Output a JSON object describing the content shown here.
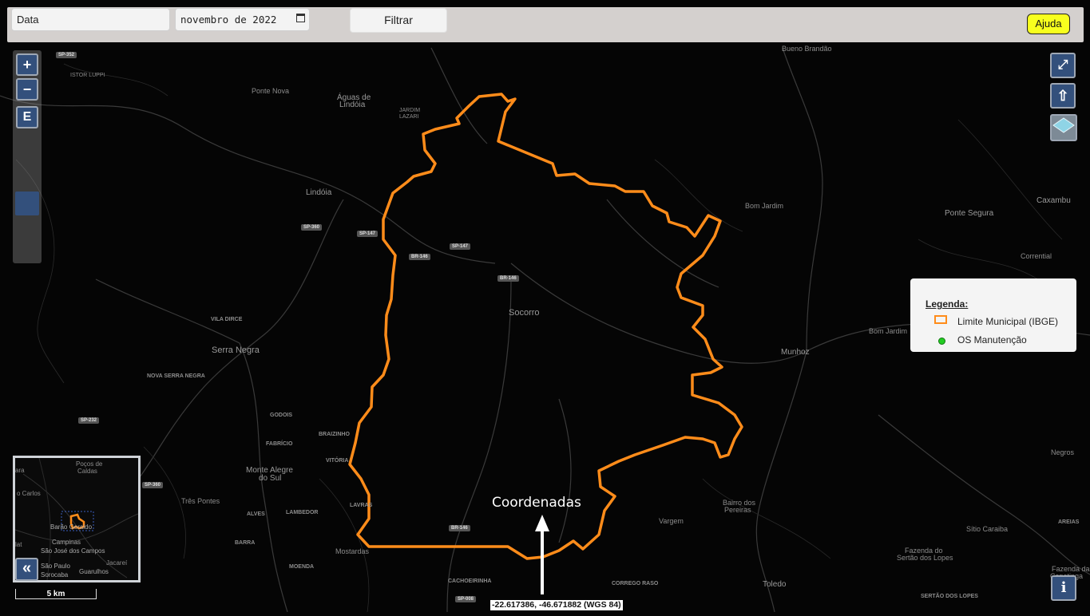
{
  "toolbar": {
    "date_label": "Data",
    "month_value": "novembro de 2022",
    "filter_label": "Filtrar",
    "help_label": "Ajuda"
  },
  "controls": {
    "zoom_in": "+",
    "zoom_out": "−",
    "extent": "E",
    "fullscreen_icon": "expand-icon",
    "home_icon": "up-arrow-icon",
    "layers_icon": "layers-icon",
    "minimap_toggle": "«",
    "info": "i"
  },
  "scale": {
    "label": "5 km"
  },
  "legend": {
    "title": "Legenda:",
    "items": [
      {
        "label": "Limite Municipal (IBGE)",
        "color": "#ff8c1a"
      },
      {
        "label": "OS Manutenção",
        "color": "#22cc22"
      }
    ]
  },
  "annotation": {
    "label": "Coordenadas"
  },
  "coordinates": {
    "readout": "-22.617386, -46.671882 (WGS 84)"
  },
  "places": {
    "bueno_brandao": "Bueno Brandão",
    "pinhalzinho_road": "SP-352",
    "istor_luppi": "ISTOR LUPPI",
    "ponte_nova": "Ponte Nova",
    "aguas": "Águas de",
    "lindoia": "Lindóia",
    "jardim": "JARDIM",
    "lazari": "LAZARI",
    "lindoia2": "Lindóia",
    "bom_jardim": "Bom Jardim",
    "ponte_segura": "Ponte Segura",
    "caxambu": "Caxambu",
    "corrential": "Corrential",
    "socorro": "Socorro",
    "vila_dirce": "VILA DIRCE",
    "serra_negra": "Serra Negra",
    "nova_serra_negra": "NOVA SERRA NEGRA",
    "bom_jardim2": "Bom Jardim",
    "munhoz": "Munhoz",
    "godois": "GODOIS",
    "fabricio": "FABRÍCIO",
    "braizinho": "BRAIZINHO",
    "vitoria": "VITÓRIA",
    "monte_alegre": "Monte Alegre",
    "do_sul": "do Sul",
    "tres_pontes": "Três Pontes",
    "alves": "ALVES",
    "lambedor": "LAMBEDOR",
    "lavras": "LAVRAS",
    "barra": "BARRA",
    "mostardas": "Mostardas",
    "moenda": "MOENDA",
    "cachoeirinha": "CACHOEIRINHA",
    "corrego_raso": "CORREGO RASO",
    "vargem": "Vargem",
    "bairro_dos": "Bairro dos",
    "pereiras": "Pereiras",
    "sitio_caraiba": "Sítio Caraiba",
    "areias": "AREIAS",
    "negros": "Negros",
    "fazenda_lopes": "Fazenda do",
    "sertao_lopes": "Sertão dos Lopes",
    "fazenda_cap": "Fazenda da",
    "capetinga": "Capetinga",
    "toledo": "Toledo",
    "sertao_dos_lopes": "SERTÃO DOS LOPES"
  },
  "roads": [
    "SP-360",
    "SP-147",
    "BR-146",
    "SP-147",
    "BR-146",
    "SP-232",
    "SP-360",
    "BR-146",
    "SP-008"
  ],
  "minimap": {
    "pocos": "Poços de",
    "caldas": "Caldas",
    "carlos": "o Carlos",
    "barao": "Barão Geraldo",
    "campinas": "Campinas",
    "sjc": "São José dos Campos",
    "sao_paulo": "São Paulo",
    "jacarei": "Jacareí",
    "sorocaba": "Sorocaba",
    "guarulhos": "Guarulhos",
    "ara": "ara",
    "lat": "lat"
  }
}
